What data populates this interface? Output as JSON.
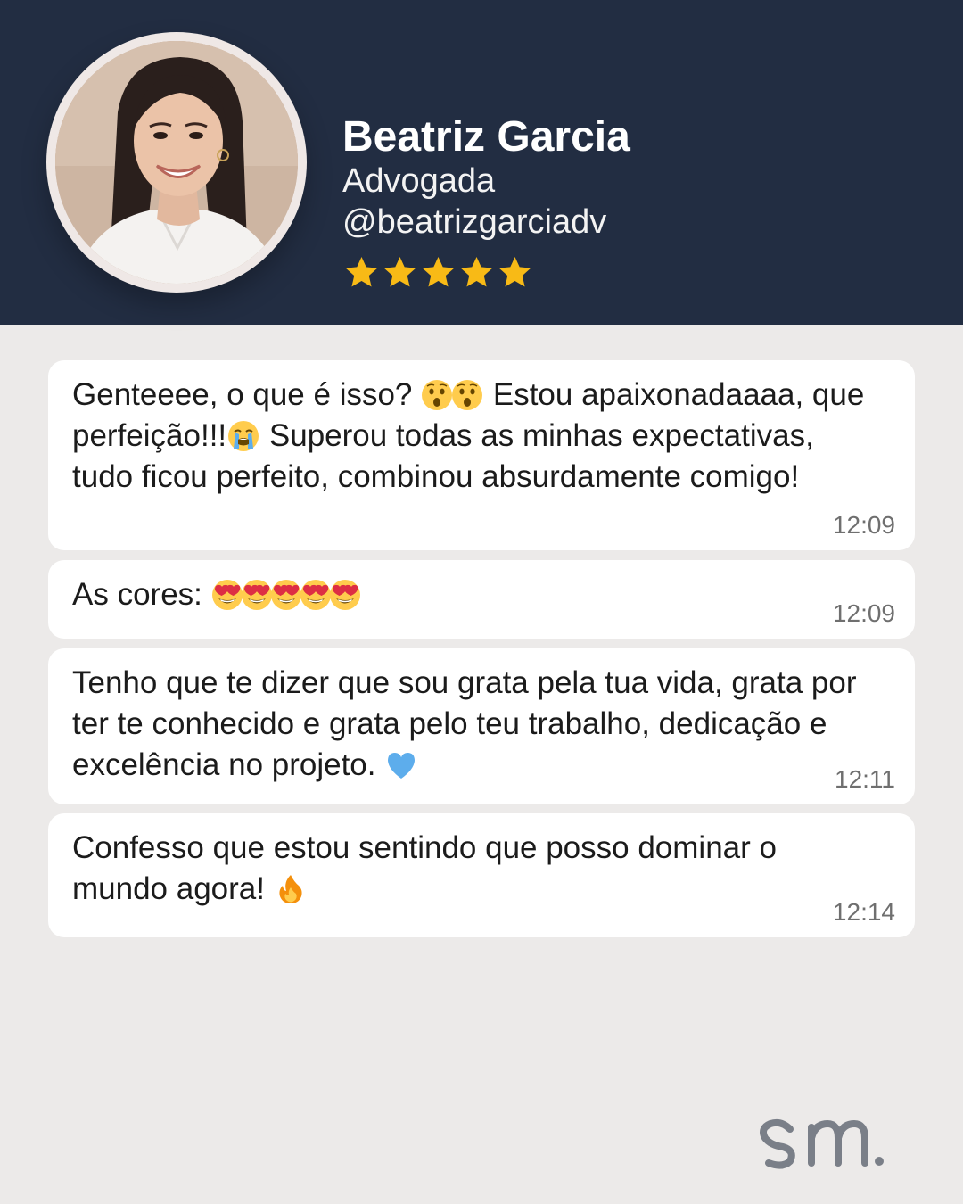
{
  "profile": {
    "name": "Beatriz Garcia",
    "role": "Advogada",
    "handle": "@beatrizgarciadv",
    "rating": 5,
    "rating_max": 5,
    "star_color": "#F8BA16"
  },
  "theme": {
    "header_bg": "#222D42",
    "page_bg": "#ECEAE9",
    "bubble_bg": "#FFFFFF"
  },
  "messages": [
    {
      "parts": [
        "Genteeee, o que é isso? ",
        " Estou apaixonadaaaa, que perfeição!!!",
        " Superou todas as minhas expectativas, tudo ficou perfeito, combinou absurdamente comigo!"
      ],
      "emojis": [
        "astonished-face",
        "astonished-face",
        "loudly-crying-face"
      ],
      "time": "12:09"
    },
    {
      "parts": [
        "As cores: "
      ],
      "emojis": [
        "heart-eyes-face",
        "heart-eyes-face",
        "heart-eyes-face",
        "heart-eyes-face",
        "heart-eyes-face"
      ],
      "time": "12:09"
    },
    {
      "parts": [
        "Tenho que te dizer que sou grata pela tua vida, grata por ter te conhecido e grata pelo teu trabalho, dedicação e excelência no projeto. "
      ],
      "emojis": [
        "blue-heart"
      ],
      "time": "12:11"
    },
    {
      "parts": [
        "Confesso que estou sentindo que posso dominar o mundo agora! "
      ],
      "emojis": [
        "fire"
      ],
      "time": "12:14"
    }
  ],
  "brand": {
    "logo_text": "sm.",
    "logo_color": "#7A7F88"
  }
}
